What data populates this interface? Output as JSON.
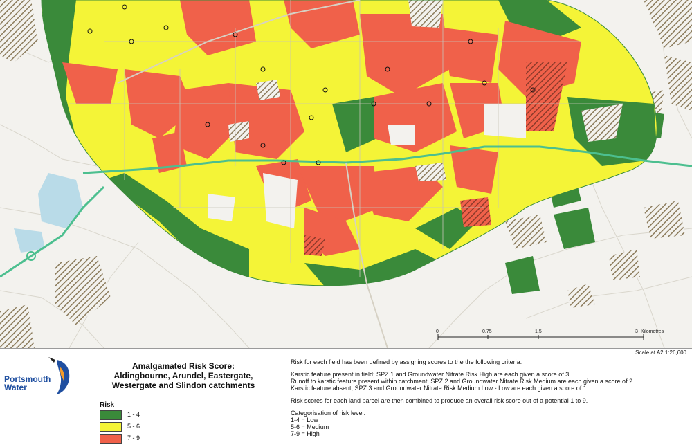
{
  "map": {
    "scale_bar": {
      "ticks": [
        "0",
        "0.75",
        "1.5",
        "3"
      ],
      "unit": "Kilometres"
    },
    "scale_caption": "Scale at A2  1:26,600",
    "colors": {
      "low": "#3a8a3a",
      "medium": "#f4f437",
      "high": "#f0614a",
      "road": "#4cbf8f",
      "hatch": "#8b7b5b",
      "water": "#b9dbe8"
    }
  },
  "logo": {
    "line1": "Portsmouth",
    "line2": "Water",
    "icon": "kingfisher-icon"
  },
  "title": {
    "line1": "Amalgamated Risk Score:",
    "line2": "Aldingbourne, Arundel, Eastergate,",
    "line3": "Westergate and Slindon catchments"
  },
  "legend": {
    "heading": "Risk",
    "items": [
      {
        "label": "1 - 4",
        "color": "#3a8a3a"
      },
      {
        "label": "5 - 6",
        "color": "#f4f437"
      },
      {
        "label": "7 - 9",
        "color": "#f0614a"
      }
    ]
  },
  "criteria": {
    "intro": "Risk for each field has been defined by assigning scores to the the following criteria:",
    "rule1": "Karstic feature present in field; SPZ 1 and Groundwater Nitrate Risk High are each given a score of 3",
    "rule2": "Runoff to karstic feature present within catchment, SPZ  2 and Groundwater Nitrate Risk Medium are each given a score of 2",
    "rule3": "Karstic feature absent, SPZ 3 and Groundwater Nitrate Risk Medium Low - Low  are each given a score of  1.",
    "combine": "Risk scores for each land parcel are then combined to produce an overall risk score out of a potential 1 to 9.",
    "cat_heading": "Categorisation of risk level:",
    "cat_low": "1-4 = Low",
    "cat_medium": "5-6 = Medium",
    "cat_high": "7-9 = High"
  }
}
